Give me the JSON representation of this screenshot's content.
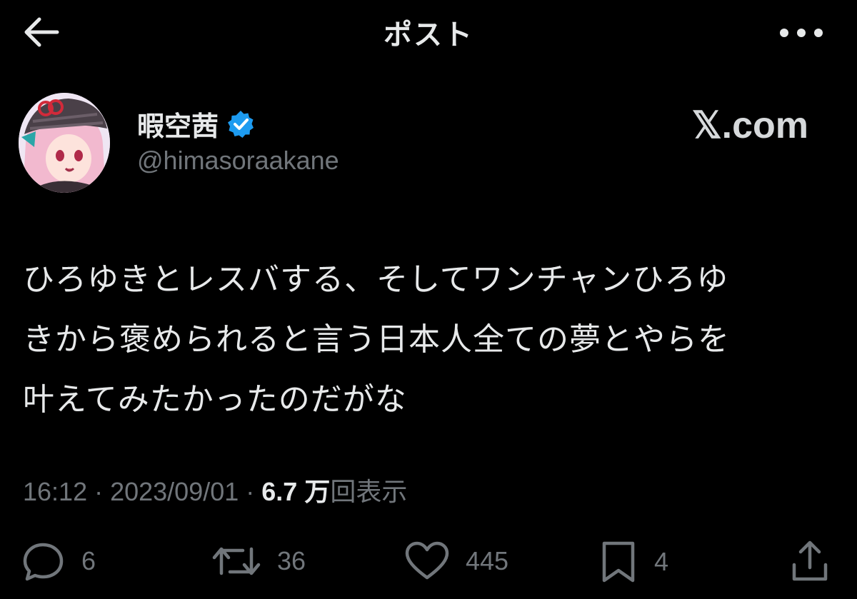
{
  "header": {
    "title": "ポスト",
    "back_icon": "arrow-left-icon",
    "more_icon": "more-horizontal-icon"
  },
  "author": {
    "display_name": "暇空茜",
    "handle": "@himasoraakane",
    "verified_color": "#1d9bf0"
  },
  "source": {
    "label": "𝕏.com"
  },
  "post": {
    "lines": [
      "ひろゆきとレスバする、そしてワンチャンひろゆ",
      "きから褒められると言う日本人全ての夢とやらを",
      "叶えてみたかったのだがな"
    ]
  },
  "meta": {
    "time": "16:12",
    "sep1": " · ",
    "date": "2023/09/01",
    "sep2": " · ",
    "views_count": "6.7 万",
    "views_label": "回表示"
  },
  "actions": {
    "replies": "6",
    "reposts": "36",
    "likes": "445",
    "bookmarks": "4"
  },
  "colors": {
    "background": "#000000",
    "text": "#e7e9ea",
    "muted": "#71767b",
    "accent": "#1d9bf0"
  }
}
